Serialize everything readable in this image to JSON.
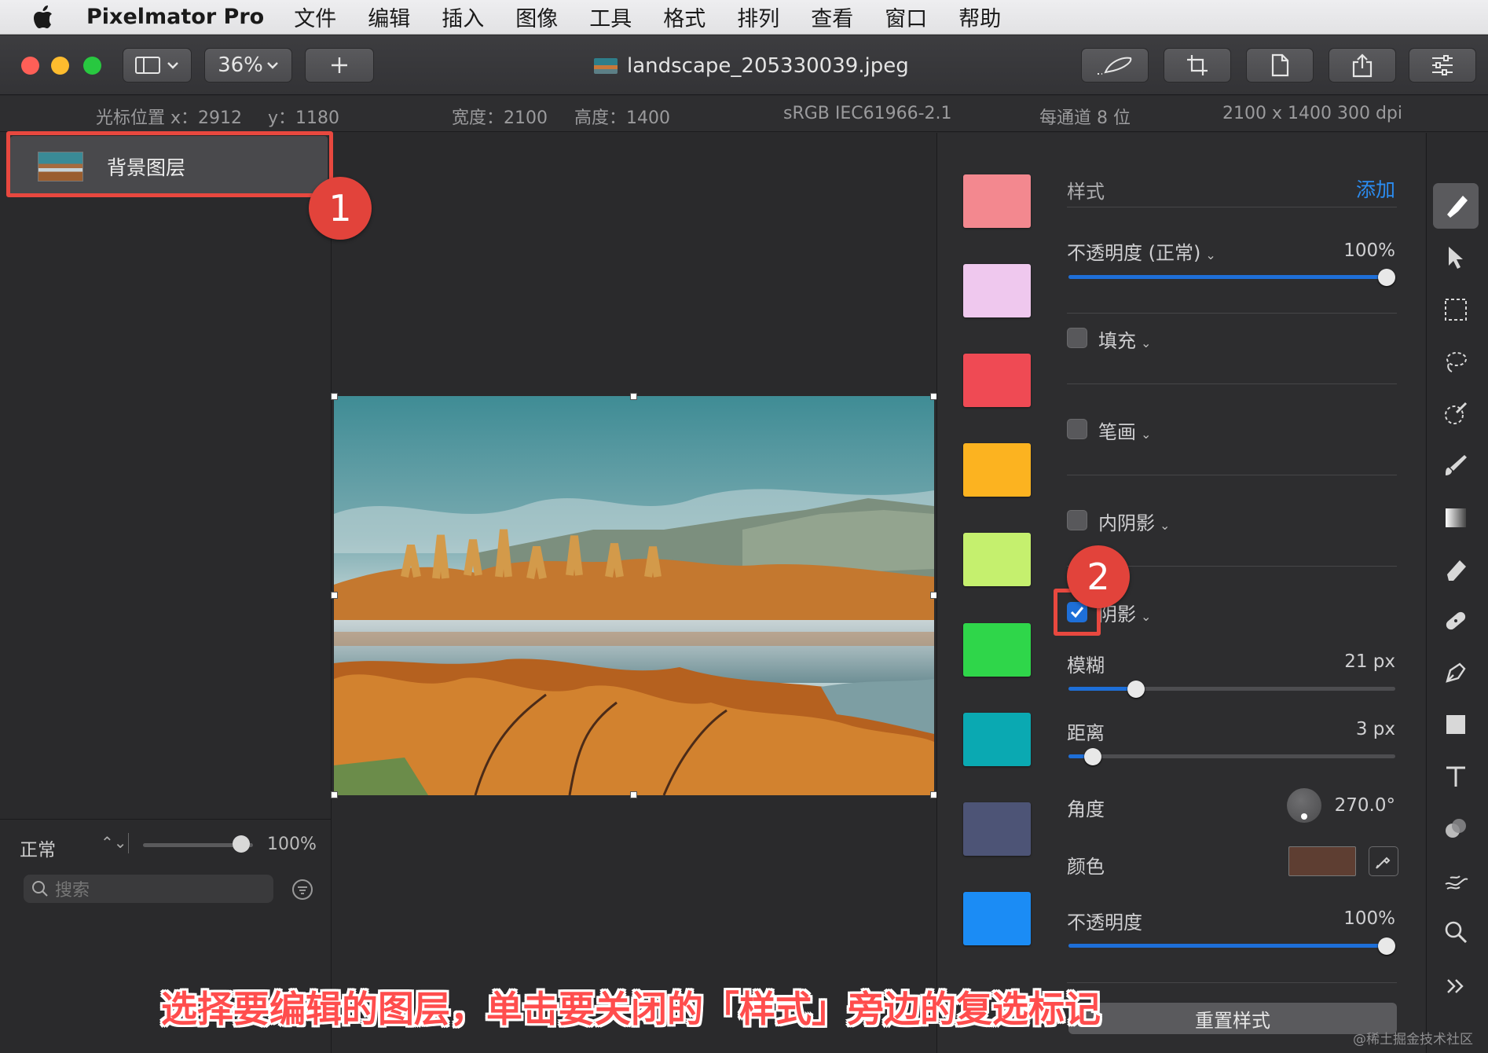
{
  "menubar": {
    "app_name": "Pixelmator Pro",
    "items": [
      "文件",
      "编辑",
      "插入",
      "图像",
      "工具",
      "格式",
      "排列",
      "查看",
      "窗口",
      "帮助"
    ]
  },
  "toolbar": {
    "zoom": "36%",
    "document_title": "landscape_205330039.jpeg"
  },
  "infobar": {
    "cursor_x": "光标位置 x：2912",
    "cursor_y": "y：1180",
    "width": "宽度：2100",
    "height": "高度：1400",
    "color_profile": "sRGB IEC61966-2.1",
    "bit_depth": "每通道 8 位",
    "dimensions": "2100 x 1400 300 dpi"
  },
  "layers": {
    "items": [
      {
        "name": "背景图层"
      }
    ],
    "blend_mode": "正常",
    "opacity": "100%",
    "search_placeholder": "搜索"
  },
  "styles_panel": {
    "header_label": "样式",
    "add_label": "添加",
    "opacity_mode_label": "不透明度 (正常)",
    "opacity_value": "100%",
    "opacity_fraction": 1.0,
    "fill": {
      "label": "填充",
      "checked": false
    },
    "stroke": {
      "label": "笔画",
      "checked": false
    },
    "inner_shadow": {
      "label": "内阴影",
      "checked": false
    },
    "shadow": {
      "label": "阴影",
      "checked": true,
      "blur_label": "模糊",
      "blur_value": "21 px",
      "blur_fraction": 0.19,
      "distance_label": "距离",
      "distance_value": "3 px",
      "distance_fraction": 0.05,
      "angle_label": "角度",
      "angle_value": "270.0°",
      "color_label": "颜色",
      "color": "#5e3e32",
      "opacity_label": "不透明度",
      "opacity_value": "100%",
      "opacity_fraction": 1.0
    },
    "reset_label": "重置样式",
    "swatches": [
      "#f3888f",
      "#efc8ee",
      "#ef4a54",
      "#fcb320",
      "#c5f06e",
      "#2fd64a",
      "#0aa9b2",
      "#4d5476",
      "#1b8cf5"
    ]
  },
  "annotations": {
    "badge_1": "1",
    "badge_2": "2",
    "caption": "选择要编辑的图层，单击要关闭的「样式」旁边的复选标记",
    "watermark": "@稀土掘金技术社区"
  },
  "colors": {
    "accent": "#1e6fd8",
    "annotation_red": "#e8483f"
  }
}
